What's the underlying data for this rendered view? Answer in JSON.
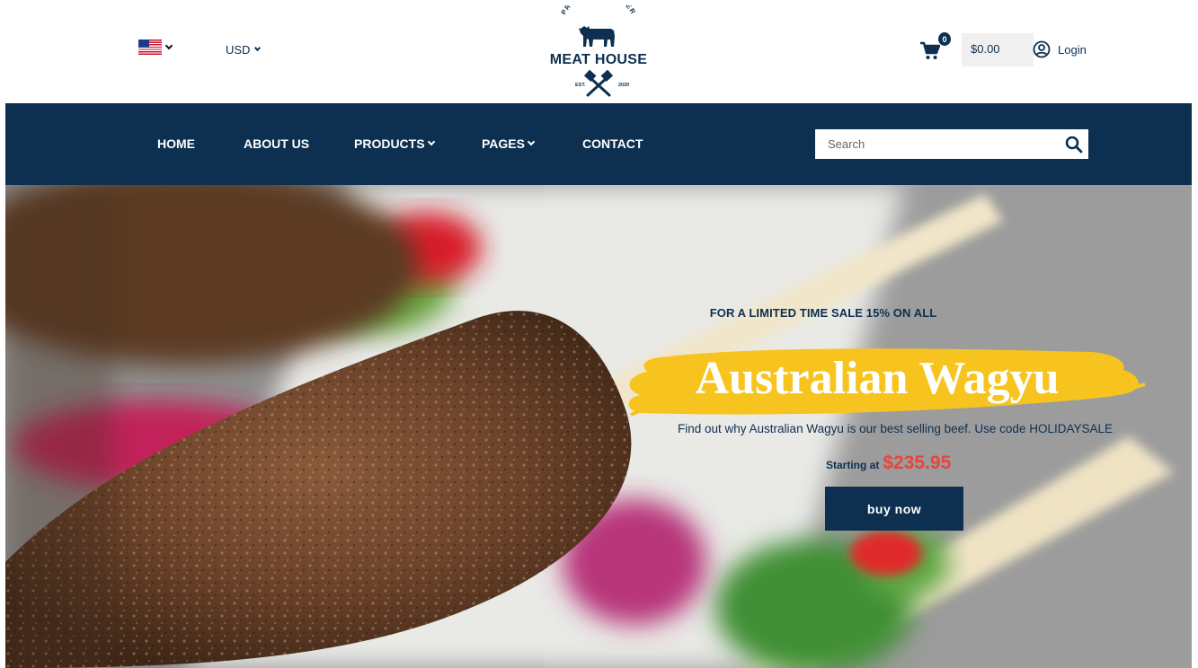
{
  "header": {
    "flag_icon": "us-flag-icon",
    "currency": "USD",
    "logo": {
      "tagline_top": "PREMIUM BUTCHER",
      "name": "MEAT HOUSE",
      "est_left": "EST.",
      "est_right": "2020"
    },
    "cart_count": "0",
    "cart_total": "$0.00",
    "login_label": "Login"
  },
  "nav": {
    "items": [
      "HOME",
      "ABOUT US",
      "PRODUCTS",
      "PAGES",
      "CONTACT"
    ],
    "search_placeholder": "Search"
  },
  "hero": {
    "promo": "FOR A LIMITED TIME SALE 15% ON ALL",
    "headline": "Australian Wagyu",
    "subtext": "Find out why Australian Wagyu is our best selling beef. Use code HOLIDAYSALE",
    "starting_label": "Starting at",
    "price": "$235.95",
    "cta": "buy now"
  },
  "colors": {
    "navy": "#0d3050",
    "accent_yellow": "#f7c41f",
    "price_red": "#e8453c"
  }
}
